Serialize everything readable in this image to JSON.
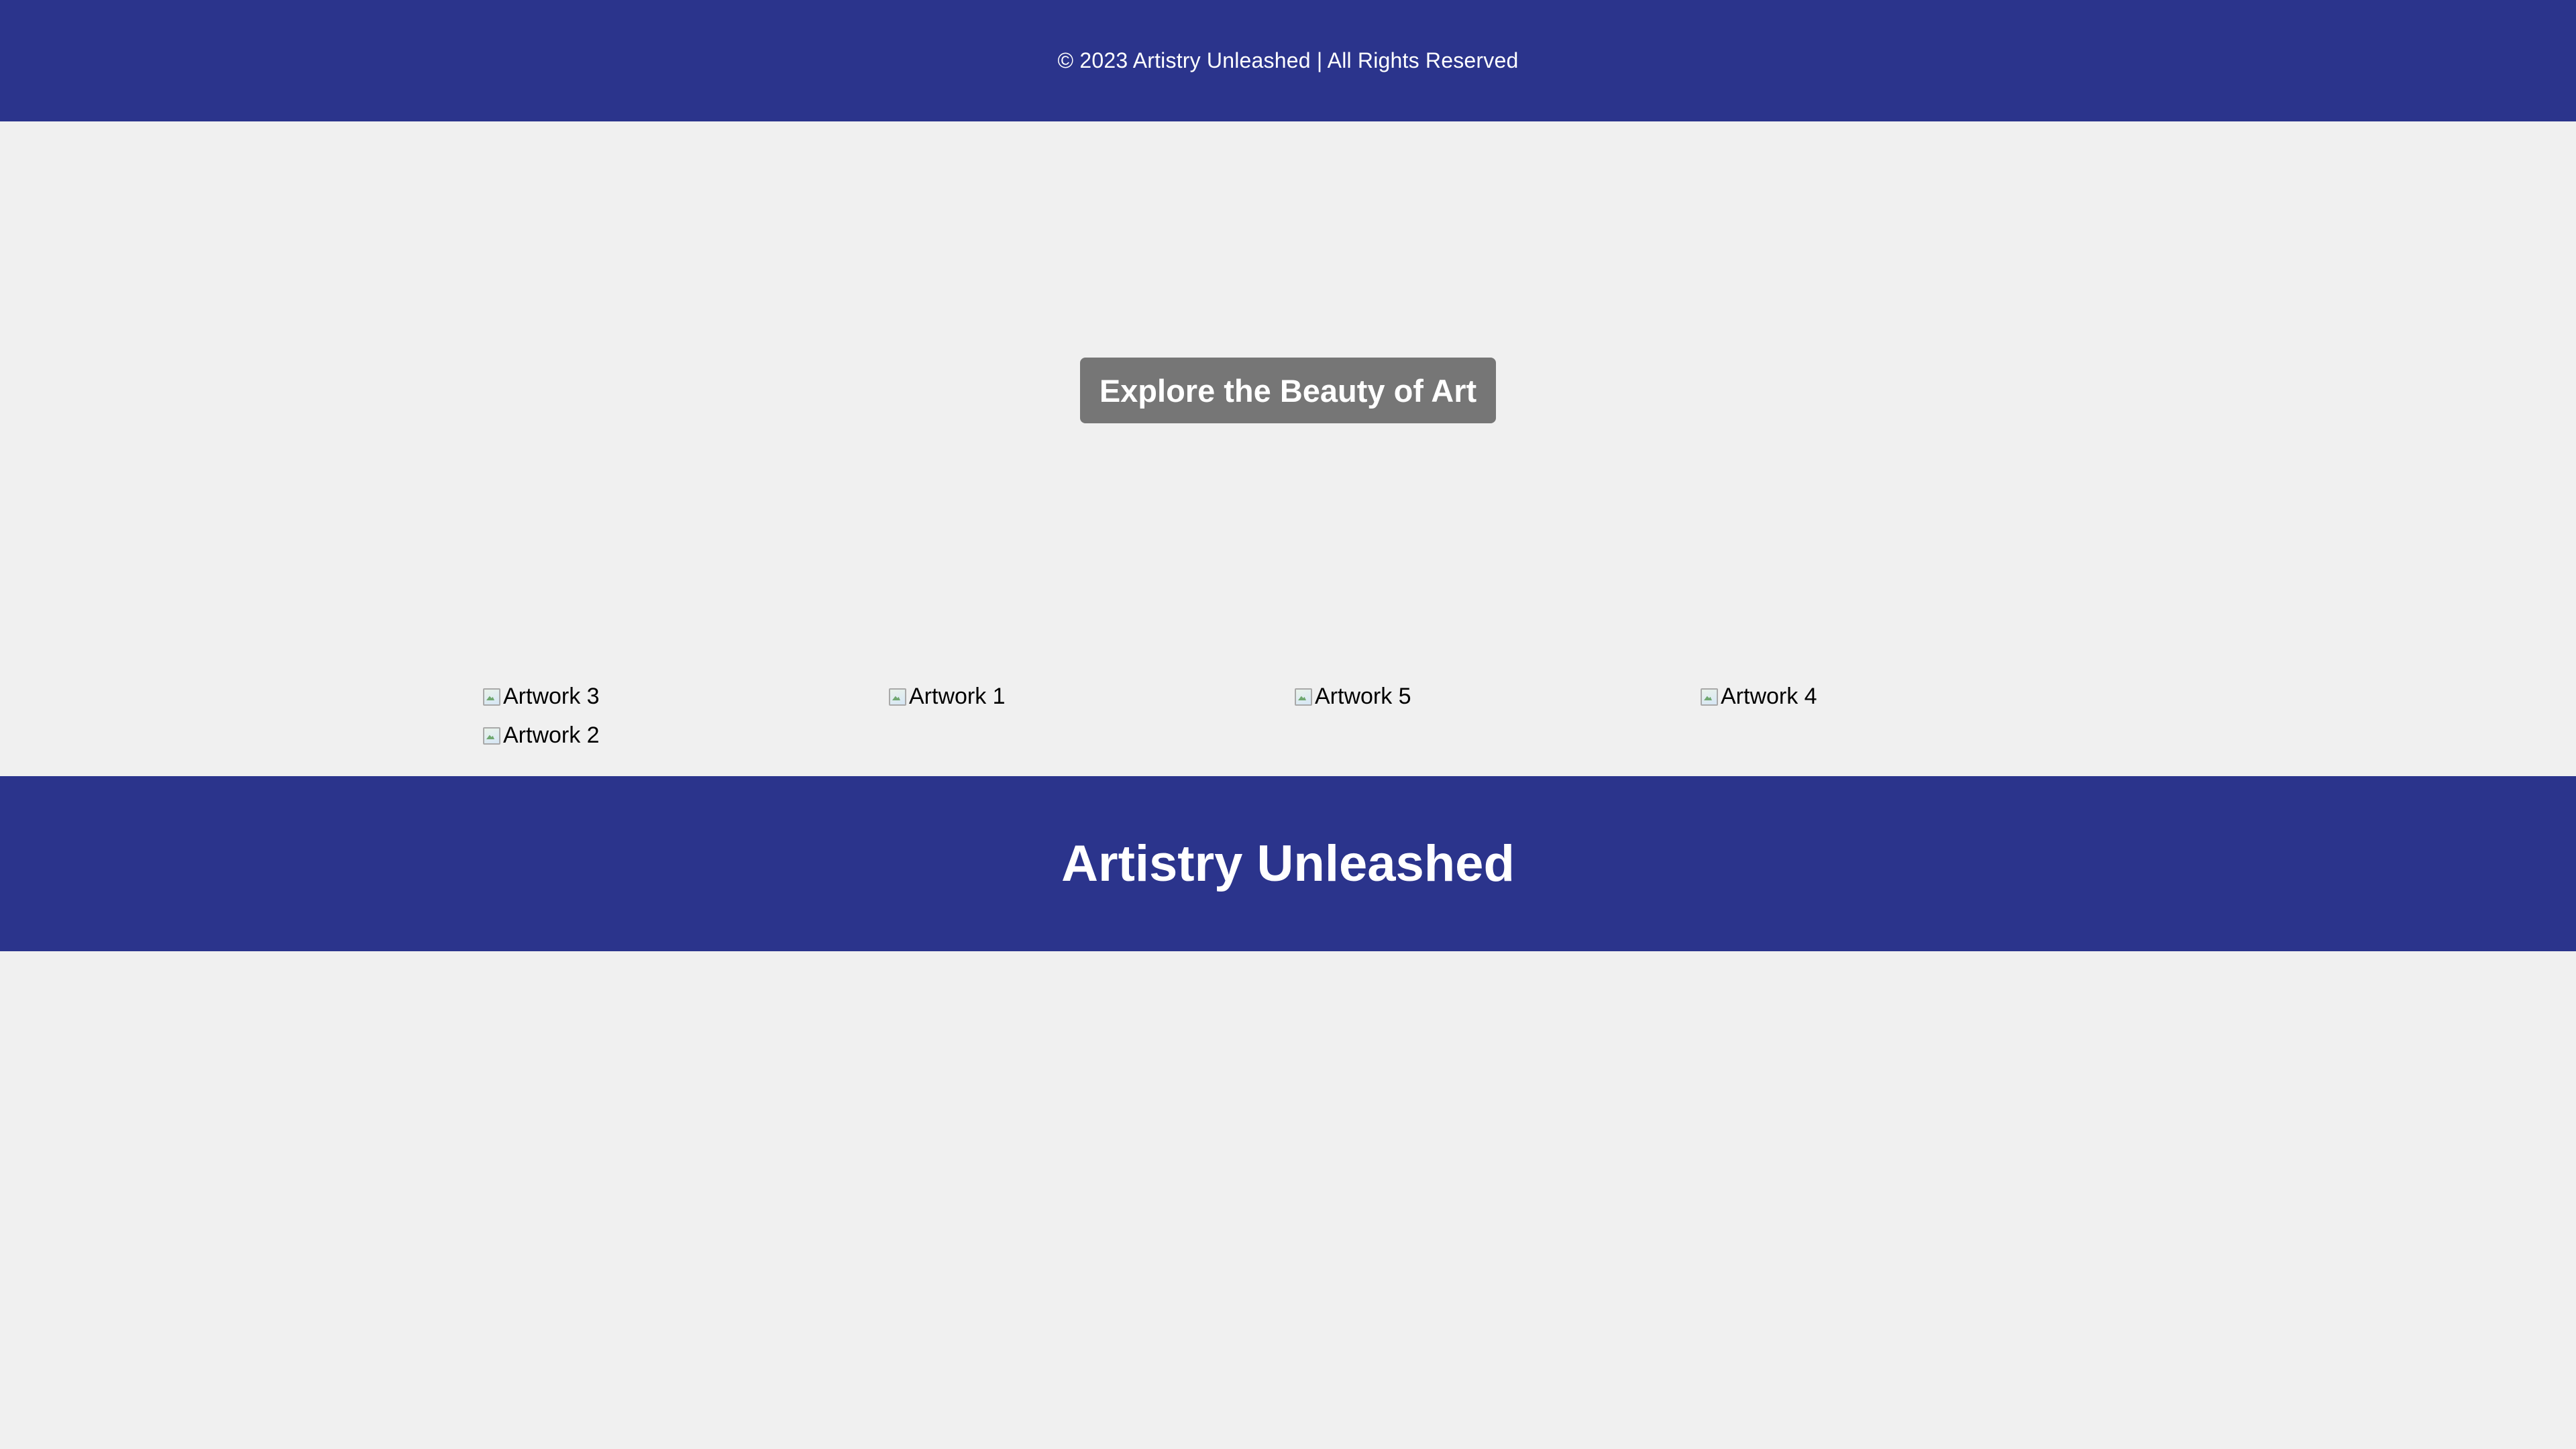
{
  "footer": {
    "copyright": "© 2023 Artistry Unleashed | All Rights Reserved"
  },
  "hero": {
    "cta_label": "Explore the Beauty of Art"
  },
  "gallery": {
    "items": [
      {
        "alt": "Artwork 3",
        "icon": "broken-image-icon"
      },
      {
        "alt": "Artwork 1",
        "icon": "broken-image-icon"
      },
      {
        "alt": "Artwork 5",
        "icon": "broken-image-icon"
      },
      {
        "alt": "Artwork 4",
        "icon": "broken-image-icon"
      },
      {
        "alt": "Artwork 2",
        "icon": "broken-image-icon"
      }
    ]
  },
  "header": {
    "title": "Artistry Unleashed"
  },
  "colors": {
    "bar_background": "#2b348c",
    "page_background": "#f0f0f0",
    "button_background": "#767676",
    "text_light": "#ffffff"
  }
}
